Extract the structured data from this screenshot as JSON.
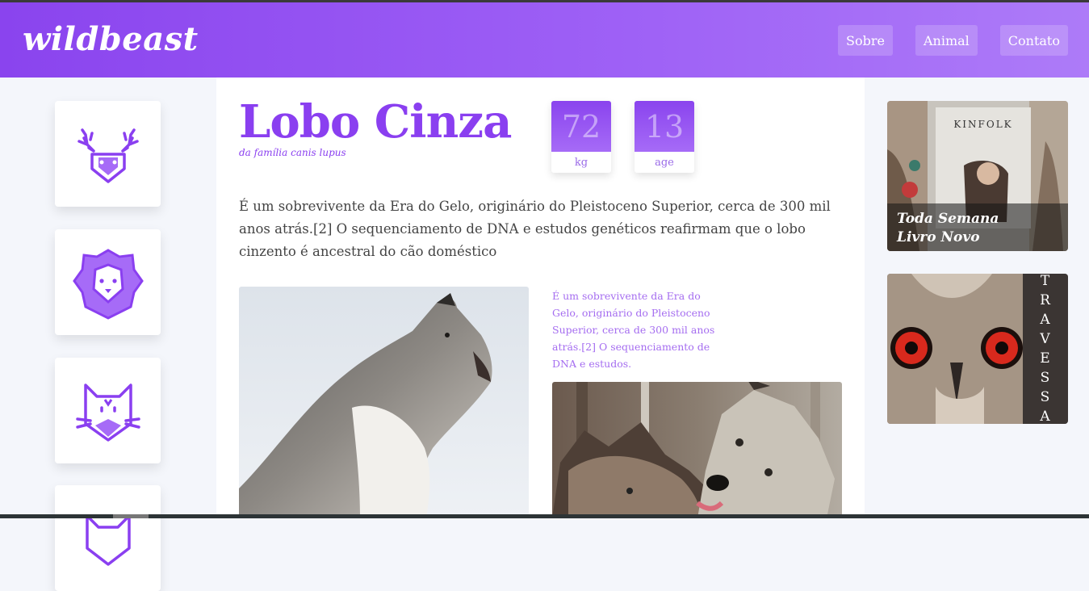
{
  "brand": {
    "logo": "wildbeast",
    "accent": "#8a3ff0"
  },
  "nav": [
    "Sobre",
    "Animal",
    "Contato"
  ],
  "sidebar": {
    "animals": [
      "deer-icon",
      "lion-icon",
      "cat-icon",
      "fox-icon"
    ]
  },
  "animal": {
    "name": "Lobo Cinza",
    "family": "da família canis lupus",
    "stats": [
      {
        "value": "72",
        "unit": "kg"
      },
      {
        "value": "13",
        "unit": "age"
      }
    ],
    "description": "É um sobrevivente da Era do Gelo, originário do Pleistoceno Superior, cerca de 300 mil anos atrás.[2] O sequenciamento de DNA e estudos genéticos reafirmam que o lobo cinzento é ancestral do cão doméstico",
    "caption": "É um sobrevivente da Era do Gelo, originário do Pleistoceno Superior, cerca de 300 mil anos atrás.[2] O sequenciamento de DNA e estudos."
  },
  "ads": {
    "book": {
      "cover_title": "KINFOLK",
      "line1": "Toda Semana",
      "line2": "Livro Novo"
    },
    "owl": {
      "letters": [
        "T",
        "R",
        "A",
        "V",
        "E",
        "S",
        "S",
        "A"
      ]
    }
  }
}
